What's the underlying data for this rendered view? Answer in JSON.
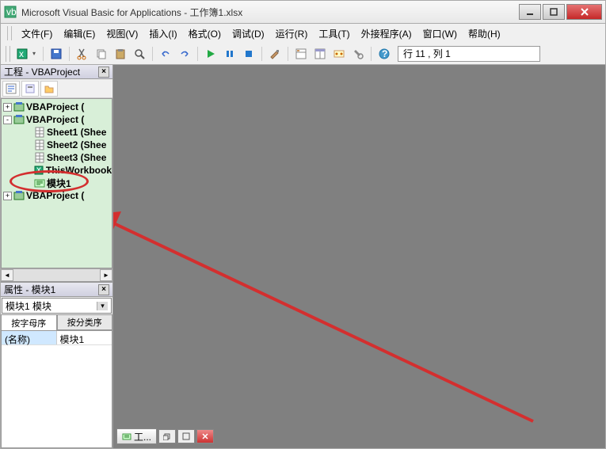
{
  "title": "Microsoft Visual Basic for Applications - 工作簿1.xlsx",
  "menus": {
    "file": "文件(F)",
    "edit": "编辑(E)",
    "view": "视图(V)",
    "insert": "插入(I)",
    "format": "格式(O)",
    "debug": "调试(D)",
    "run": "运行(R)",
    "tools": "工具(T)",
    "addins": "外接程序(A)",
    "window": "窗口(W)",
    "help": "帮助(H)"
  },
  "cursor_position": "行 11 , 列 1",
  "project_panel": {
    "title": "工程 - VBAProject",
    "tree": [
      {
        "expand": "+",
        "icon": "vba",
        "label": "VBAProject (",
        "indent": 0
      },
      {
        "expand": "-",
        "icon": "vba",
        "label": "VBAProject (",
        "indent": 0
      },
      {
        "expand": "",
        "icon": "sheet",
        "label": "Sheet1 (Shee",
        "indent": 2
      },
      {
        "expand": "",
        "icon": "sheet",
        "label": "Sheet2 (Shee",
        "indent": 2
      },
      {
        "expand": "",
        "icon": "sheet",
        "label": "Sheet3 (Shee",
        "indent": 2
      },
      {
        "expand": "",
        "icon": "wb",
        "label": "ThisWorkbook",
        "indent": 2
      },
      {
        "expand": "",
        "icon": "module",
        "label": "模块1",
        "indent": 2
      },
      {
        "expand": "+",
        "icon": "vba",
        "label": "VBAProject (",
        "indent": 0
      }
    ]
  },
  "properties_panel": {
    "title": "属性 - 模块1",
    "combo": "模块1 模块",
    "tab_alpha": "按字母序",
    "tab_cat": "按分类序",
    "rows": [
      {
        "key": "(名称)",
        "val": "模块1"
      }
    ]
  },
  "mdi": {
    "tab_label": "工..."
  },
  "colors": {
    "tree_bg": "#d8efd8",
    "annotation": "#d32f2f"
  }
}
